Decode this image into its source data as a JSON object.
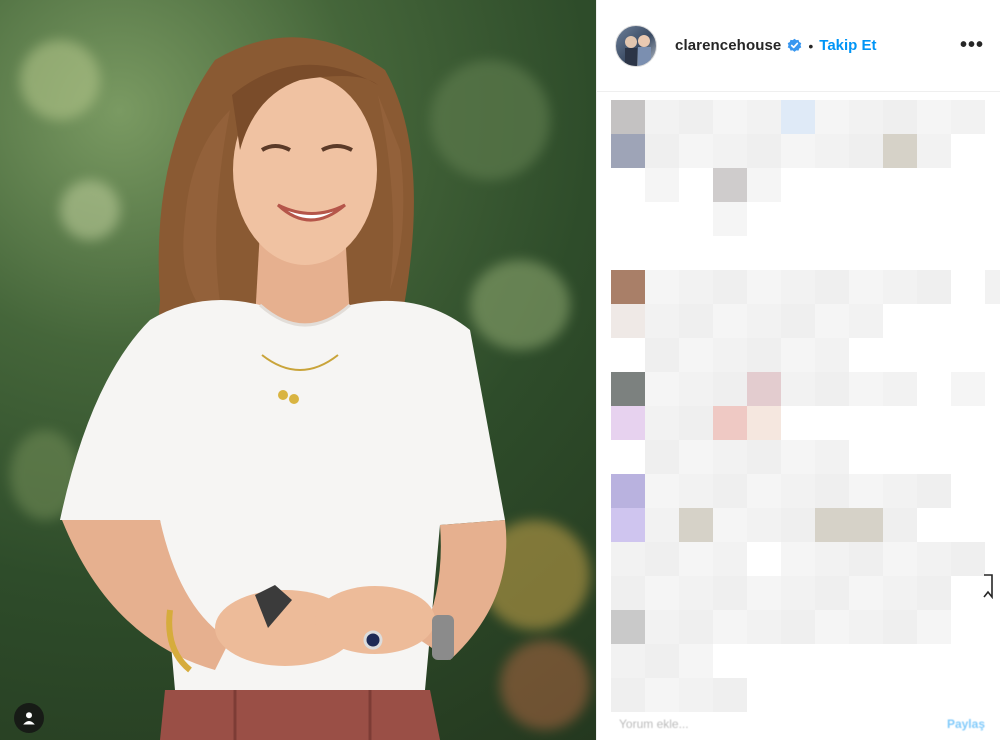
{
  "post": {
    "account": {
      "username": "clarencehouse",
      "verified": true,
      "separator": "•",
      "follow_label": "Takip Et",
      "more_label": "•••"
    },
    "comment_input": {
      "placeholder": "Yorum ekle..."
    },
    "share_label": "Paylaş",
    "colors": {
      "follow_blue": "#0095f6",
      "verified_blue": "#3897f0",
      "username_text": "#262626",
      "muted_text": "#8e8e8e"
    },
    "icons": [
      "user-tag-icon",
      "verified-badge-icon",
      "more-options-icon",
      "bookmark-icon"
    ]
  }
}
